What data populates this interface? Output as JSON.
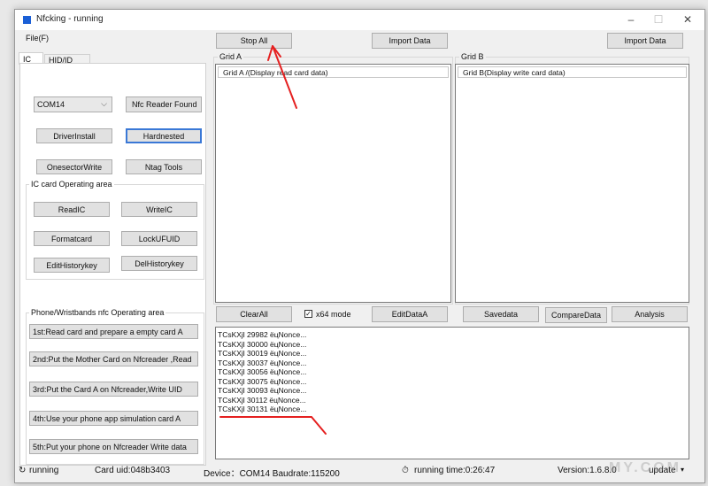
{
  "window": {
    "title": "Nfcking - running",
    "controls": {
      "minimize": "–",
      "maximize": "☐",
      "close": "✕"
    }
  },
  "menu": {
    "file": "File(F)"
  },
  "toolbar": {
    "stop_all": "Stop All",
    "import_data_a": "Import Data",
    "import_data_b": "Import Data"
  },
  "tabs": [
    {
      "label": "IC"
    },
    {
      "label": "HID/ID RW"
    }
  ],
  "left": {
    "port": "COM14",
    "nfc_reader_found": "Nfc Reader Found",
    "driver_install": "DriverInstall",
    "hardnested": "Hardnested",
    "onesector_write": "OnesectorWrite",
    "ntag_tools": "Ntag Tools",
    "ic_group_title": "IC card Operating area",
    "read_ic": "ReadIC",
    "write_ic": "WriteIC",
    "format_card": "Formatcard",
    "lock_ufuid": "LockUFUID",
    "edit_history_key": "EditHistorykey",
    "del_history_key": "DelHistorykey",
    "phone_group_title": "Phone/Wristbands nfc Operating area",
    "steps": [
      "1st:Read card and prepare a empty card A",
      "2nd:Put the Mother Card on Nfcreader ,Read",
      "3rd:Put the Card A on Nfcreader,Write UID",
      "4th:Use your phone app simulation card A",
      "5th:Put your phone on Nfcreader Write data"
    ]
  },
  "grid_a": {
    "title": "Grid A",
    "header": "Grid A /(Display read card data)"
  },
  "grid_b": {
    "title": "Grid B",
    "header": "Grid B(Display write card data)"
  },
  "actions": {
    "clear_all": "ClearAll",
    "x64_mode": "x64 mode",
    "x64_checked": true,
    "edit_data_a": "EditDataA",
    "save_data": "Savedata",
    "compare_data": "CompareData",
    "analysis": "Analysis"
  },
  "log": [
    "TCsKXjl 29982 ёцNonce...",
    "TCsKXjl 30000 ёцNonce...",
    "TCsKXjl 30019 ёцNonce...",
    "TCsKXjl 30037 ёцNonce...",
    "TCsKXjl 30056 ёцNonce...",
    "TCsKXjl 30075 ёцNonce...",
    "TCsKXjl 30093 ёцNonce...",
    "TCsKXjl 30112 ёцNonce...",
    "TCsKXjl 30131 ёцNonce..."
  ],
  "status": {
    "state": "running",
    "card_uid": "Card uid:048b3403",
    "device": "Device：COM14  Baudrate:115200",
    "running_time": "running time:0:26:47",
    "version": "Version:1.6.8.0",
    "update": "update"
  },
  "watermark": "MY.COM",
  "colors": {
    "annotation_red": "#e52020",
    "accent_blue": "#1a5fd6"
  }
}
